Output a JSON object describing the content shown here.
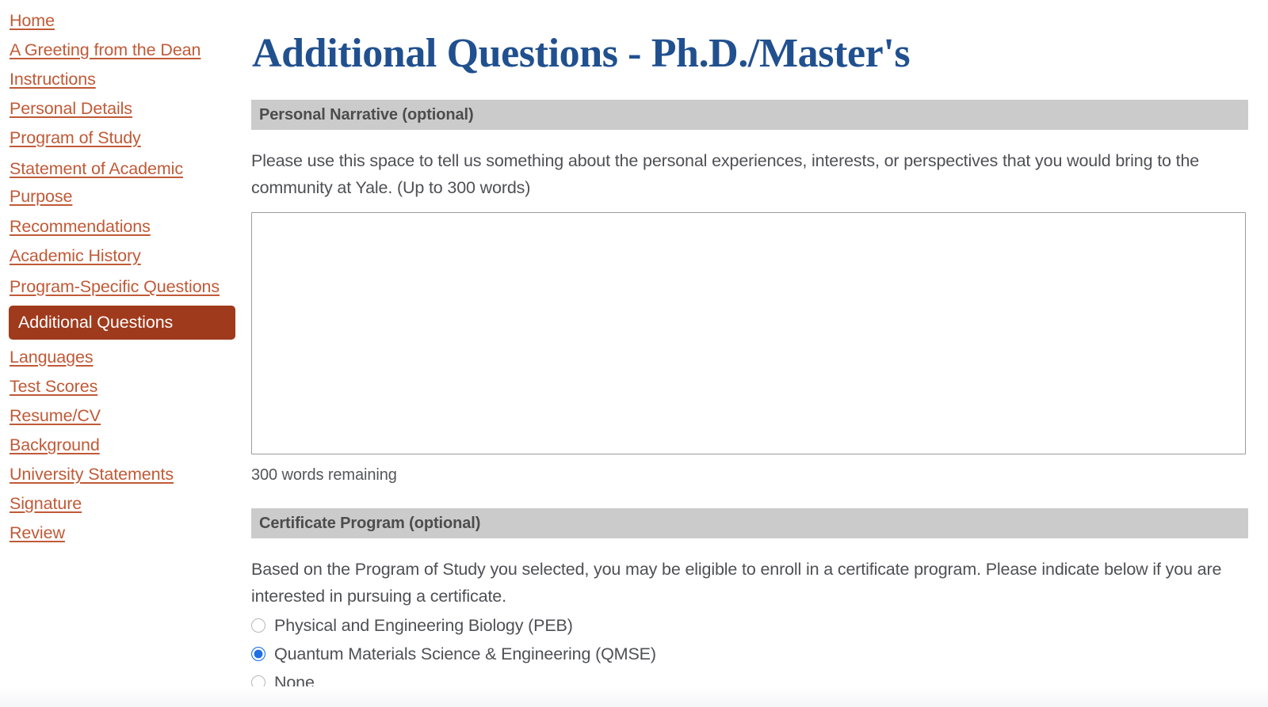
{
  "sidebar": {
    "items": [
      {
        "label": "Home",
        "active": false
      },
      {
        "label": "A Greeting from the Dean",
        "active": false
      },
      {
        "label": "Instructions",
        "active": false
      },
      {
        "label": "Personal Details",
        "active": false
      },
      {
        "label": "Program of Study",
        "active": false
      },
      {
        "label": "Statement of Academic Purpose",
        "active": false
      },
      {
        "label": "Recommendations",
        "active": false
      },
      {
        "label": "Academic History",
        "active": false
      },
      {
        "label": "Program-Specific Questions",
        "active": false
      },
      {
        "label": "Additional Questions",
        "active": true
      },
      {
        "label": "Languages",
        "active": false
      },
      {
        "label": "Test Scores",
        "active": false
      },
      {
        "label": "Resume/CV",
        "active": false
      },
      {
        "label": "Background",
        "active": false
      },
      {
        "label": "University Statements",
        "active": false
      },
      {
        "label": "Signature",
        "active": false
      },
      {
        "label": "Review",
        "active": false
      }
    ]
  },
  "main": {
    "title": "Additional Questions - Ph.D./Master's",
    "sections": {
      "personal_narrative": {
        "header": "Personal Narrative (optional)",
        "prompt": "Please use this space to tell us something about the personal experiences, interests, or perspectives that you would bring to the community at Yale. (Up to 300 words)",
        "textarea_value": "",
        "textarea_placeholder": "",
        "words_remaining": "300 words remaining"
      },
      "certificate_program": {
        "header": "Certificate Program (optional)",
        "prompt": "Based on the Program of Study you selected, you may be eligible to enroll in a certificate program. Please indicate below if you are interested in pursuing a certificate.",
        "options": [
          {
            "label": "Physical and Engineering Biology (PEB)",
            "selected": false
          },
          {
            "label": "Quantum Materials Science & Engineering (QMSE)",
            "selected": true
          },
          {
            "label": "None",
            "selected": false
          }
        ]
      }
    }
  },
  "colors": {
    "link": "#c05a37",
    "active_nav_bg": "#a03a1c",
    "title_blue": "#21508f",
    "section_header_bg": "#cbcbcb",
    "radio_selected": "#1f6fe5",
    "body_text": "#4f5054"
  }
}
